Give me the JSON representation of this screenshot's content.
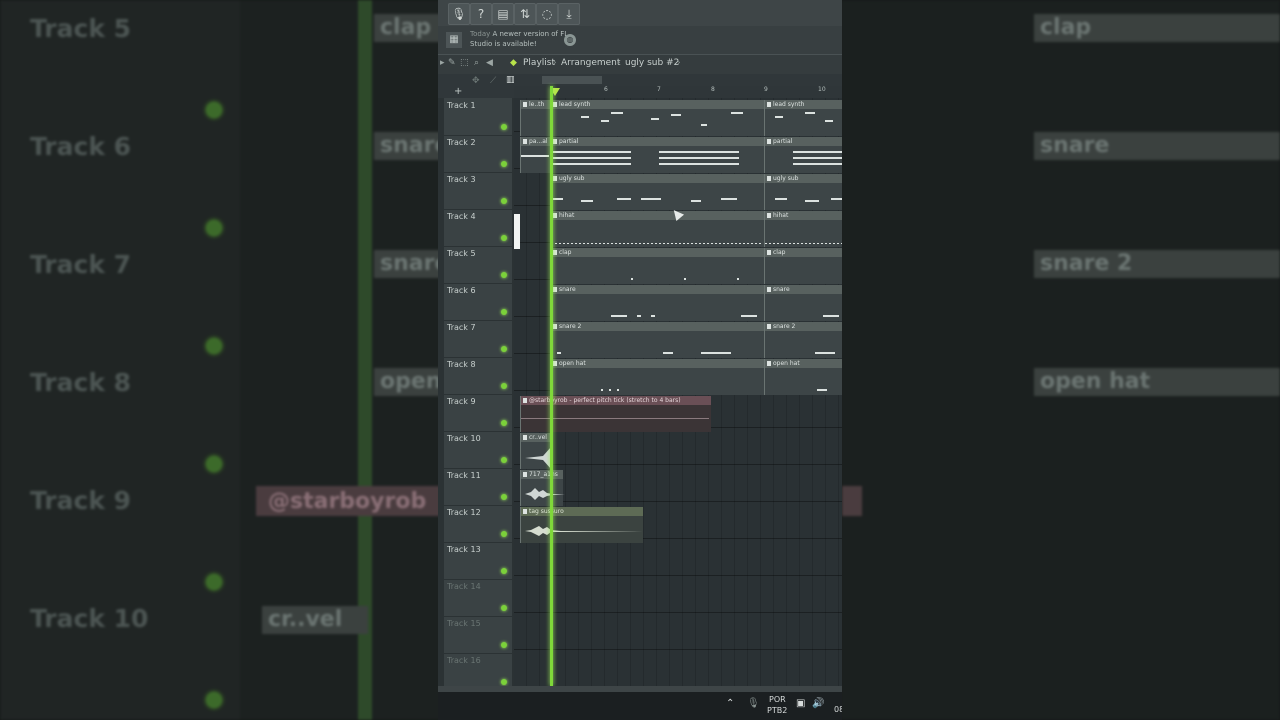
{
  "app": {
    "news_today": "Today",
    "news_message": "A newer version of FL Studio is available!",
    "breadcrumb": [
      "Playlist",
      "Arrangement",
      "ugly sub #2"
    ]
  },
  "ruler_ticks": [
    "6",
    "7",
    "8",
    "9",
    "10"
  ],
  "tracks": [
    {
      "name": "Track 1"
    },
    {
      "name": "Track 2"
    },
    {
      "name": "Track 3"
    },
    {
      "name": "Track 4"
    },
    {
      "name": "Track 5"
    },
    {
      "name": "Track 6"
    },
    {
      "name": "Track 7"
    },
    {
      "name": "Track 8"
    },
    {
      "name": "Track 9"
    },
    {
      "name": "Track 10"
    },
    {
      "name": "Track 11"
    },
    {
      "name": "Track 12"
    },
    {
      "name": "Track 13"
    },
    {
      "name": "Track 14"
    },
    {
      "name": "Track 15"
    },
    {
      "name": "Track 16"
    }
  ],
  "clips": {
    "t1a": "le..th",
    "t1b": "lead synth",
    "t1c": "lead synth",
    "t2a": "pa...al",
    "t2b": "partial",
    "t2c": "partial",
    "t3b": "ugly sub",
    "t3c": "ugly sub",
    "t4b": "hihat",
    "t4c": "hihat",
    "t5b": "clap",
    "t5c": "clap",
    "t6b": "snare",
    "t6c": "snare",
    "t7b": "snare 2",
    "t7c": "snare 2",
    "t8b": "open hat",
    "t8c": "open hat",
    "t9": "@starboyrob - perfect pitch tick (stretch to 4 bars)",
    "t10": "cr..vel",
    "t11": "717_a1ns",
    "t12": "tag sussuro"
  },
  "taskbar": {
    "lang1": "POR",
    "lang2": "PTB2",
    "time": "08"
  },
  "background": {
    "tracks": [
      "Track 5",
      "Track 6",
      "Track 7",
      "Track 8",
      "Track 9",
      "Track 10"
    ],
    "left_clips": [
      "clap",
      "snare",
      "snare",
      "open",
      "@starboyrob",
      "cr..vel"
    ],
    "right_clips": [
      "clap",
      "snare",
      "snare 2",
      "open hat"
    ]
  }
}
